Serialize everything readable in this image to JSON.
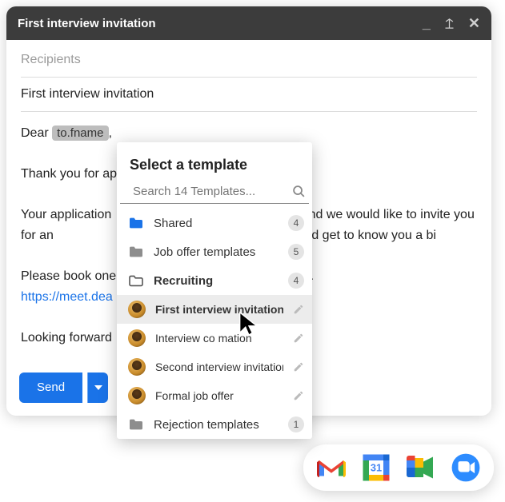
{
  "titlebar": {
    "title": "First interview invitation"
  },
  "fields": {
    "recipients_placeholder": "Recipients",
    "subject": "First interview invitation"
  },
  "body": {
    "greeting_pre": "Dear ",
    "greeting_chip": "to.fname",
    "greeting_post": ",",
    "p1": "Thank you for ap",
    "p2a": "Your application",
    "p2b": "s and we would like to invite you for an",
    "p2c": "cuss the role and get to know you a bi",
    "p3a": "Please book one",
    "p3b": "r.",
    "link": "https://meet.dea",
    "p4": "Looking forward"
  },
  "footer": {
    "send_label": "Send"
  },
  "popover": {
    "title": "Select a template",
    "search_placeholder": "Search 14 Templates...",
    "folders": [
      {
        "label": "Shared",
        "count": "4",
        "type": "blue"
      },
      {
        "label": "Job offer templates",
        "count": "5",
        "type": "grey"
      },
      {
        "label": "Recruiting",
        "count": "4",
        "type": "open"
      },
      {
        "label": "Rejection templates",
        "count": "1",
        "type": "grey"
      }
    ],
    "templates": [
      {
        "label": "First interview invitation"
      },
      {
        "label": "Interview co         mation"
      },
      {
        "label": "Second interview invitation"
      },
      {
        "label": "Formal job offer"
      }
    ]
  },
  "dock": {
    "apps": [
      "gmail",
      "calendar",
      "meet",
      "zoom"
    ],
    "cal_day": "31"
  }
}
